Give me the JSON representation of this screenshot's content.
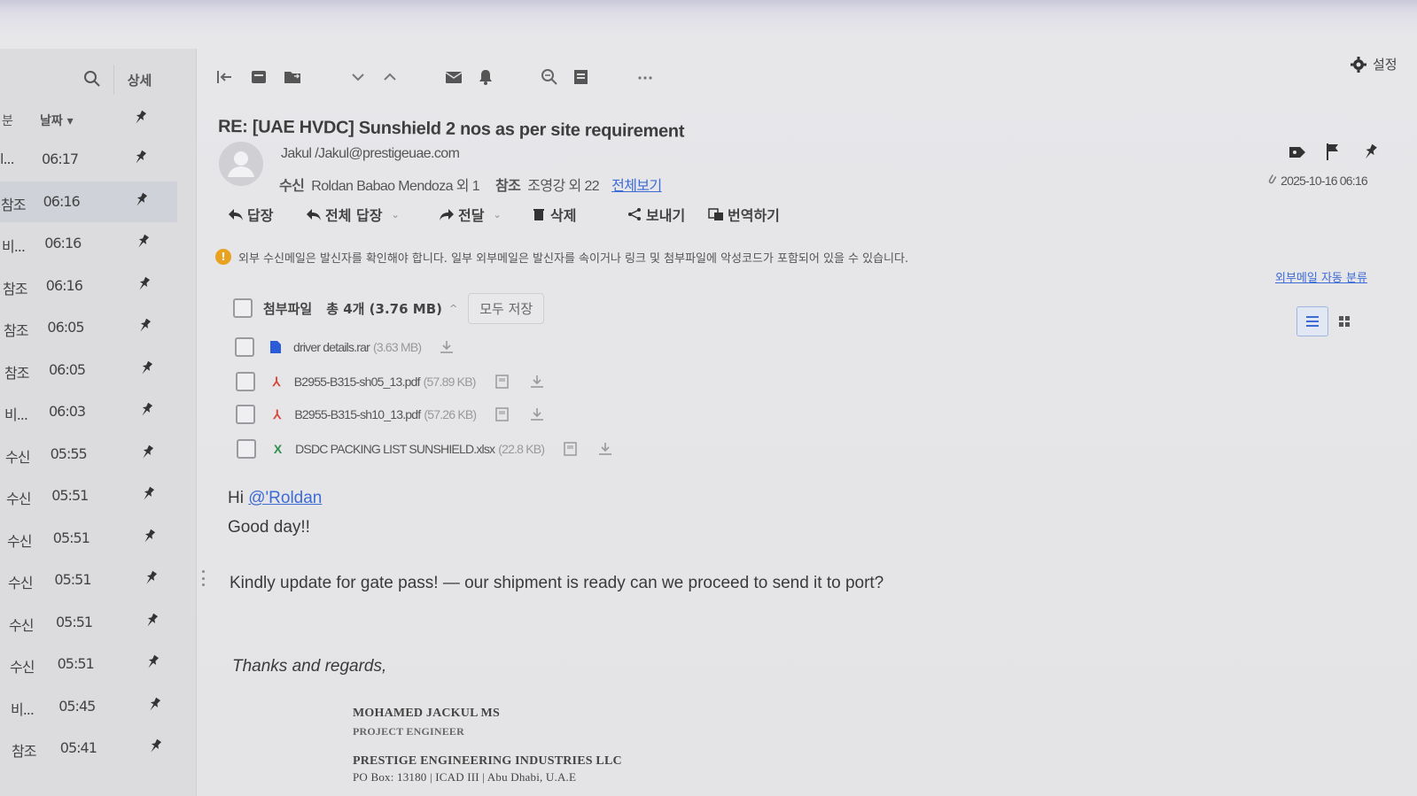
{
  "sidebar": {
    "detail_label": "상세",
    "header": {
      "col_a": "분",
      "sort_label": "날짜 ▾"
    },
    "rows": [
      {
        "kind": "l...",
        "time": "06:17"
      },
      {
        "kind": "참조",
        "time": "06:16"
      },
      {
        "kind": "비...",
        "time": "06:16"
      },
      {
        "kind": "참조",
        "time": "06:16"
      },
      {
        "kind": "참조",
        "time": "06:05"
      },
      {
        "kind": "참조",
        "time": "06:05"
      },
      {
        "kind": "비...",
        "time": "06:03"
      },
      {
        "kind": "수신",
        "time": "05:55"
      },
      {
        "kind": "수신",
        "time": "05:51"
      },
      {
        "kind": "수신",
        "time": "05:51"
      },
      {
        "kind": "수신",
        "time": "05:51"
      },
      {
        "kind": "수신",
        "time": "05:51"
      },
      {
        "kind": "수신",
        "time": "05:51"
      },
      {
        "kind": "비...",
        "time": "05:45"
      },
      {
        "kind": "참조",
        "time": "05:41"
      }
    ]
  },
  "top_right": {
    "settings_label": "설정"
  },
  "email": {
    "subject": "RE: [UAE HVDC] Sunshield 2 nos as per site requirement",
    "sender": "Jakul /Jakul@prestigeuae.com",
    "to_label": "수신",
    "to_value": "Roldan Babao Mendoza 외 1",
    "cc_label": "참조",
    "cc_value": "조영강 외 22",
    "view_all": "전체보기",
    "date": "2025-10-16 06:16"
  },
  "actions": {
    "reply": "답장",
    "reply_all": "전체 답장",
    "forward": "전달",
    "delete": "삭제",
    "send": "보내기",
    "translate": "번역하기"
  },
  "warning": {
    "text": "외부 수신메일은 발신자를 확인해야 합니다. 일부 외부메일은 발신자를 속이거나 링크 및 첨부파일에 악성코드가 포함되어 있을 수 있습니다.",
    "auto_class": "외부메일 자동 분류"
  },
  "attachments": {
    "label": "첨부파일",
    "count": "총 4개 (3.76 MB)",
    "save_all": "모두 저장",
    "files": [
      {
        "name": "driver details.rar",
        "size": "(3.63 MB)",
        "icon": "rar-file-icon"
      },
      {
        "name": "B2955-B315-sh05_13.pdf",
        "size": "(57.89 KB)",
        "icon": "pdf-file-icon"
      },
      {
        "name": "B2955-B315-sh10_13.pdf",
        "size": "(57.26 KB)",
        "icon": "pdf-file-icon"
      },
      {
        "name": "DSDC PACKING LIST SUNSHIELD.xlsx",
        "size": "(22.8 KB)",
        "icon": "excel-file-icon"
      }
    ]
  },
  "body": {
    "greeting": "Hi",
    "mention": "@'Roldan",
    "line1": "Good day!!",
    "line2": "Kindly update for gate pass! — our shipment is ready can we proceed to send it to port?",
    "thanks": "Thanks and regards,",
    "sig_name": "MOHAMED JACKUL MS",
    "sig_title": "PROJECT ENGINEER",
    "sig_company": "PRESTIGE ENGINEERING INDUSTRIES LLC",
    "sig_address": "PO Box: 13180 | ICAD III | Abu Dhabi, U.A.E"
  },
  "colors": {
    "link": "#3d6bd6",
    "warning": "#e8a21f",
    "pdf": "#d9463a",
    "excel": "#2f8f4e",
    "rar": "#2c5bd8"
  }
}
